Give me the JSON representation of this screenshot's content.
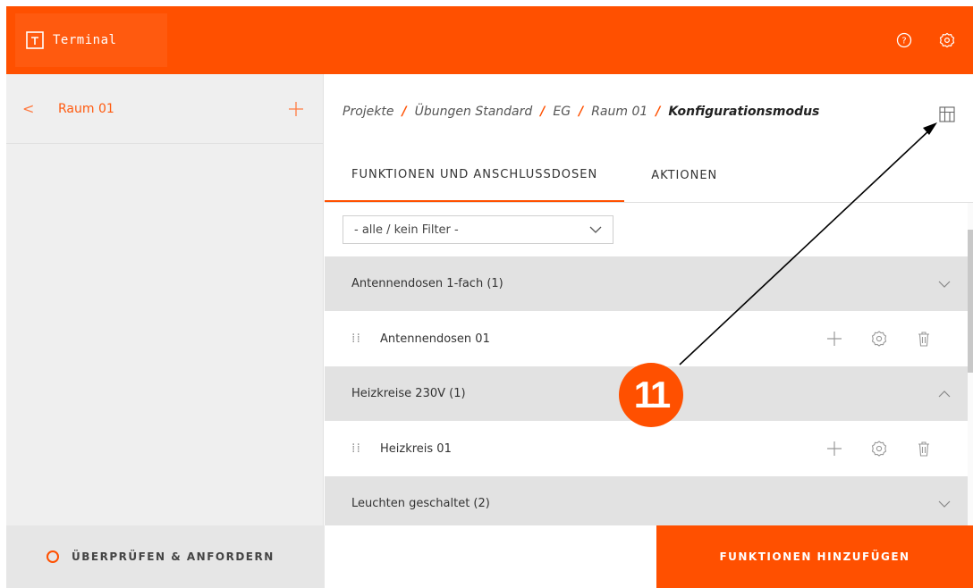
{
  "header": {
    "app_name": "Terminal",
    "brand_icon": "terminal-logo-icon",
    "help_icon": "help-icon",
    "settings_icon": "gear-icon",
    "accent_color": "#ff5000"
  },
  "sidebar": {
    "room_name": "Raum 01",
    "back_icon": "chevron-left-icon",
    "add_icon": "plus-icon",
    "back_glyph": "<"
  },
  "breadcrumb": {
    "items": [
      "Projekte",
      "Übungen Standard",
      "EG",
      "Raum 01"
    ],
    "current": "Konfigurationsmodus",
    "separator": "/"
  },
  "tabs": [
    {
      "label": "FUNKTIONEN UND ANSCHLUSSDOSEN",
      "active": true
    },
    {
      "label": "AKTIONEN",
      "active": false
    }
  ],
  "filter": {
    "selected": "- alle / kein Filter -"
  },
  "groups": [
    {
      "title": "Antennendosen 1-fach (1)",
      "expanded": false,
      "items": []
    },
    {
      "title": "",
      "expanded": true,
      "items": [
        "Antennendosen 01"
      ]
    },
    {
      "title": "Heizkreise 230V (1)",
      "expanded": true,
      "items": [
        "Heizkreis 01"
      ]
    },
    {
      "title": "Leuchten geschaltet (2)",
      "expanded": false,
      "items": []
    }
  ],
  "rows": {
    "group1": "Antennendosen 1-fach (1)",
    "item1": "Antennendosen 01",
    "group2": "Heizkreise 230V (1)",
    "item2": "Heizkreis 01",
    "group3": "Leuchten geschaltet (2)"
  },
  "drag_glyph": "⁞⁞",
  "footer": {
    "check_label": "ÜBERPRÜFEN & ANFORDERN",
    "add_label": "FUNKTIONEN HINZUFÜGEN"
  },
  "annotation": {
    "number": "11"
  }
}
